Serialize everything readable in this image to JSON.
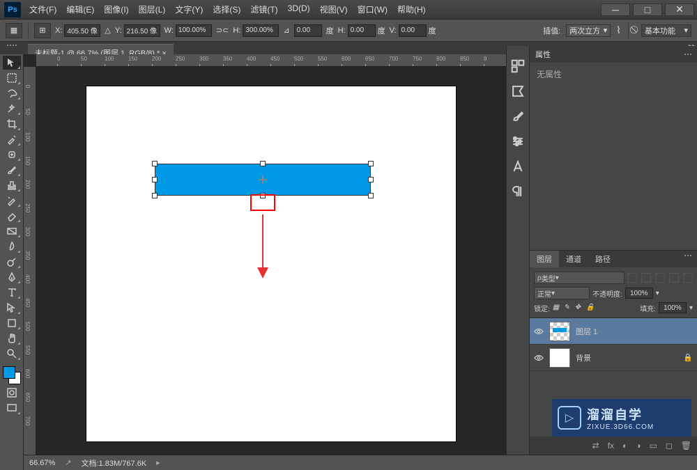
{
  "app": {
    "logo": "Ps"
  },
  "menu": [
    "文件(F)",
    "编辑(E)",
    "图像(I)",
    "图层(L)",
    "文字(Y)",
    "选择(S)",
    "滤镜(T)",
    "3D(D)",
    "视图(V)",
    "窗口(W)",
    "帮助(H)"
  ],
  "options": {
    "x_label": "X:",
    "x": "405.50 像",
    "y_label": "Y:",
    "y": "216.50 像",
    "w_label": "W:",
    "w": "100.00%",
    "h_label": "H:",
    "h": "300.00%",
    "rot": "0.00",
    "rot_unit": "度",
    "hskew_label": "H:",
    "hskew": "0.00",
    "hskew_unit": "度",
    "vskew_label": "V:",
    "vskew": "0.00",
    "vskew_unit": "度",
    "interp_label": "插值:",
    "interp": "两次立方",
    "workspace": "基本功能"
  },
  "tab": {
    "title": "未标题-1 @ 66.7% (图层 1, RGB/8) *"
  },
  "ruler_h": [
    "0",
    "50",
    "100",
    "150",
    "200",
    "250",
    "300",
    "350",
    "400",
    "450",
    "500",
    "550",
    "600",
    "650",
    "700",
    "750",
    "800",
    "850",
    "9"
  ],
  "ruler_v": [
    "0",
    "50",
    "100",
    "150",
    "200",
    "250",
    "300",
    "350",
    "400",
    "450",
    "500",
    "550",
    "600",
    "650",
    "700"
  ],
  "properties": {
    "title": "属性",
    "body": "无属性"
  },
  "layers": {
    "tabs": [
      "图层",
      "通道",
      "路径"
    ],
    "kind": "类型",
    "blend": "正常",
    "opacity_label": "不透明度:",
    "opacity": "100%",
    "lock_label": "锁定:",
    "fill_label": "填充:",
    "fill": "100%",
    "items": [
      {
        "name": "图层 1",
        "selected": true,
        "transparent": true
      },
      {
        "name": "背景",
        "selected": false,
        "transparent": false
      }
    ]
  },
  "status": {
    "zoom": "66.67%",
    "doc_label": "文档:",
    "doc": "1.83M/767.6K"
  },
  "watermark": {
    "brand": "溜溜自学",
    "url": "ZIXUE.3D66.COM"
  },
  "colors": {
    "accent": "#0099e5",
    "annotation": "#f00"
  }
}
